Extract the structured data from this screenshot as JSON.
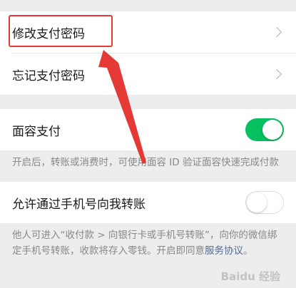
{
  "settings": {
    "change_password": "修改支付密码",
    "forgot_password": "忘记支付密码",
    "face_pay": {
      "label": "面容支付",
      "enabled": true,
      "note": "开启后，转账或消费时，可使用面容 ID 验证面容快速完成付款"
    },
    "phone_transfer": {
      "label": "允许通过手机号向我转账",
      "enabled": false,
      "note": "他人可进入“收付款 > 向银行卡或手机号转账”，向你的微信绑定手机号转账，收款将存入零钱。开启即同意",
      "note_link": "服务协议",
      "note_end": "。"
    }
  },
  "annotation": {
    "color": "#e53935"
  },
  "watermark": "Baidu 经验"
}
